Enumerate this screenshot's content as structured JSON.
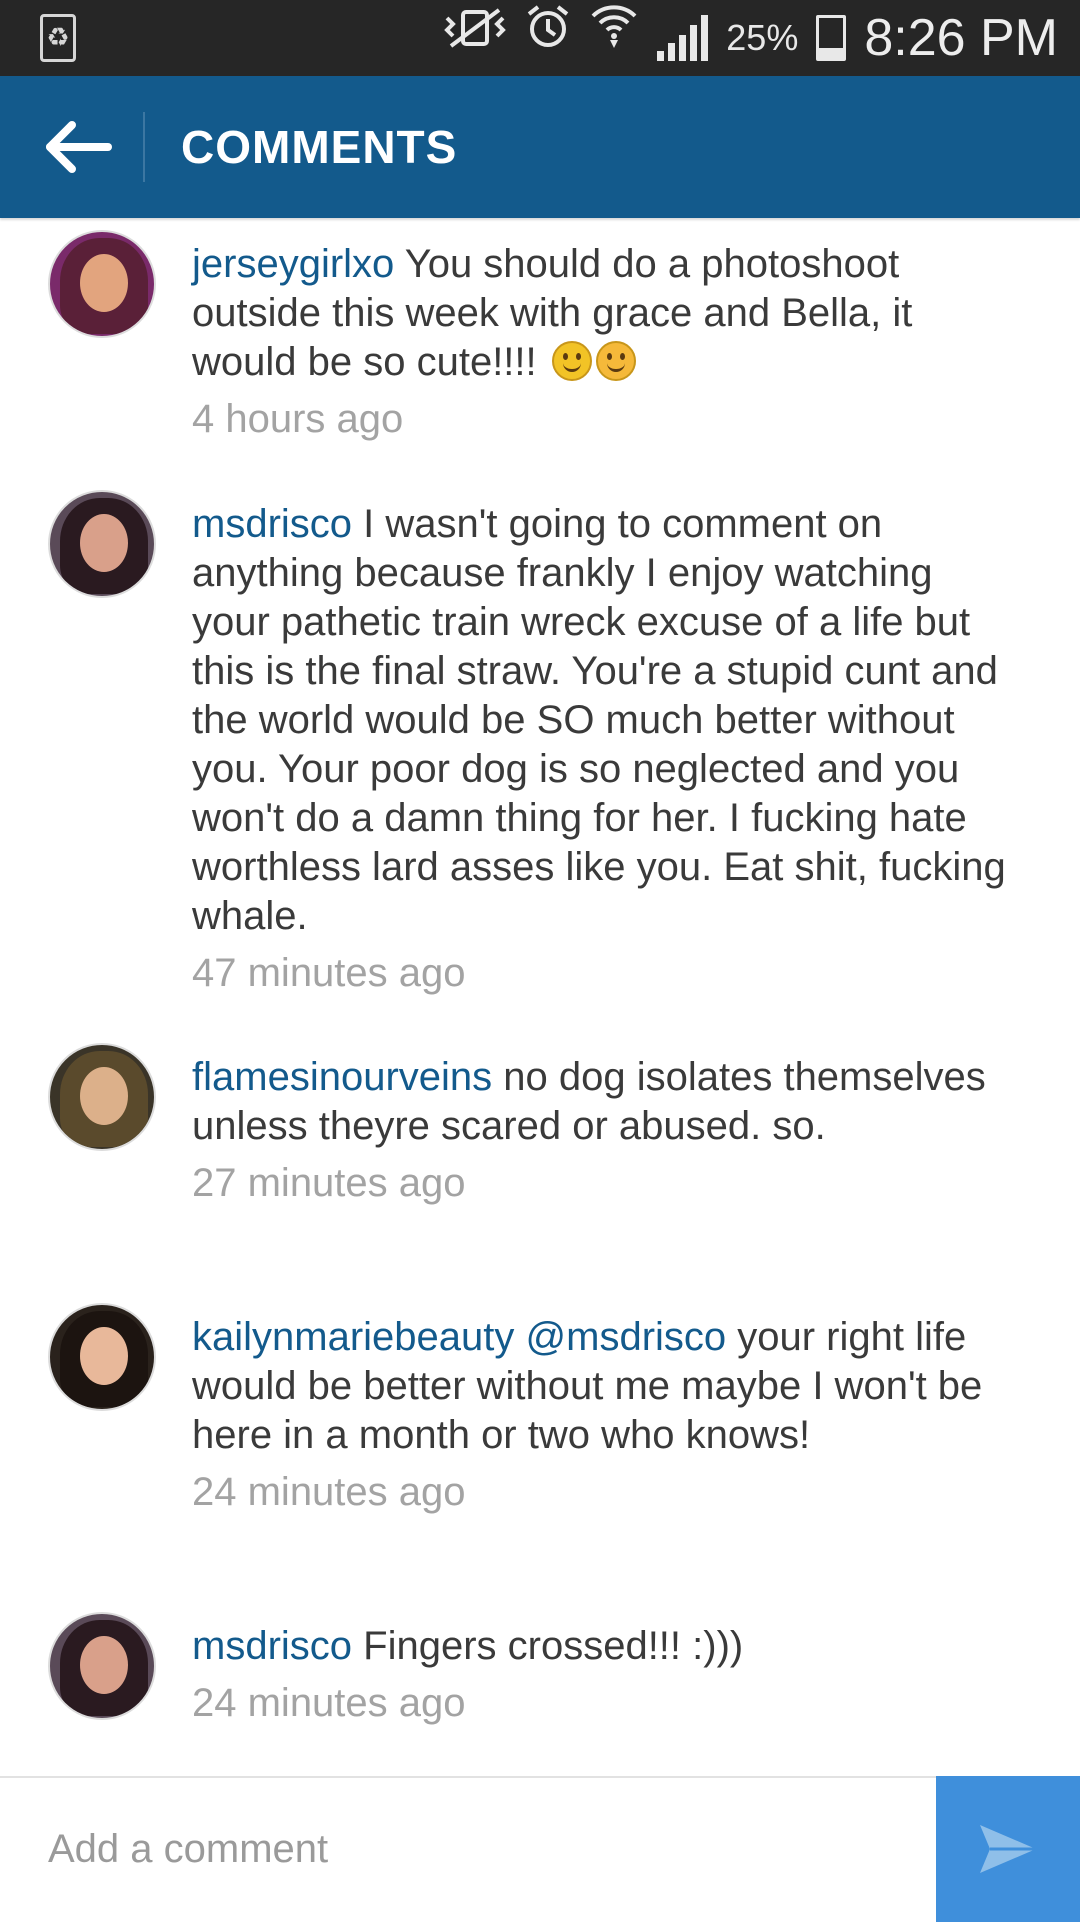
{
  "status_bar": {
    "battery_percent": "25%",
    "battery_level": 0.25,
    "time": "8:26 PM",
    "icons": [
      "recycle-icon",
      "mute-vibrate-icon",
      "alarm-icon",
      "wifi-icon",
      "signal-icon",
      "battery-icon"
    ]
  },
  "header": {
    "title": "COMMENTS",
    "back_icon": "arrow-left-icon",
    "background": "#135a8c"
  },
  "comments": [
    {
      "username": "jerseygirlxo",
      "text": " You should do a photoshoot outside this week with grace and Bella, it would be so cute!!!! ",
      "emojis": [
        "slightly-smiling-face",
        "smiling-face-with-smiling-eyes"
      ],
      "time": "4 hours ago"
    },
    {
      "username": "msdrisco",
      "text": " I wasn't going to comment on anything because frankly I enjoy watching your pathetic train wreck excuse of a life but this is the final straw. You're a stupid cunt and the world would be SO much better without you. Your poor dog is so neglected and you won't do a damn thing for her. I fucking hate worthless lard asses like you. Eat shit, fucking whale.",
      "time": "47 minutes ago"
    },
    {
      "username": "flamesinourveins",
      "text": " no dog isolates themselves unless theyre scared or abused. so.",
      "time": "27 minutes ago"
    },
    {
      "username": "kailynmariebeauty",
      "mention": "@msdrisco",
      "text": " your right life would be better without me maybe I won't be here in a month or two who knows!",
      "time": "24 minutes ago"
    },
    {
      "username": "msdrisco",
      "text": " Fingers crossed!!! :)))",
      "time": "24 minutes ago"
    }
  ],
  "compose": {
    "placeholder": "Add a comment",
    "send_icon": "send-icon",
    "send_color": "#3f8fdb"
  }
}
